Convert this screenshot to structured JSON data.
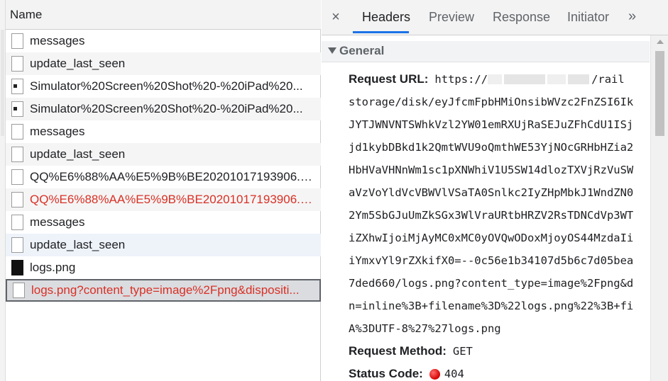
{
  "list": {
    "header": "Name",
    "rows": [
      {
        "name": "messages",
        "icon": "document-icon",
        "error": false
      },
      {
        "name": "update_last_seen",
        "icon": "document-icon",
        "error": false
      },
      {
        "name": "Simulator%20Screen%20Shot%20-%20iPad%20...",
        "icon": "image-file-icon",
        "error": false
      },
      {
        "name": "Simulator%20Screen%20Shot%20-%20iPad%20...",
        "icon": "image-file-icon",
        "error": false
      },
      {
        "name": "messages",
        "icon": "document-icon",
        "error": false
      },
      {
        "name": "update_last_seen",
        "icon": "document-icon",
        "error": false
      },
      {
        "name": "QQ%E6%88%AA%E5%9B%BE20201017193906.p...",
        "icon": "document-icon",
        "error": false
      },
      {
        "name": "QQ%E6%88%AA%E5%9B%BE20201017193906.p...",
        "icon": "document-icon",
        "error": true
      },
      {
        "name": "messages",
        "icon": "document-icon",
        "error": false
      },
      {
        "name": "update_last_seen",
        "icon": "document-icon",
        "error": false
      },
      {
        "name": "logs.png",
        "icon": "image-thumbnail-icon",
        "error": false
      },
      {
        "name": "logs.png?content_type=image%2Fpng&dispositi...",
        "icon": "document-icon",
        "error": true
      }
    ]
  },
  "tabs": {
    "close": "×",
    "items": [
      "Headers",
      "Preview",
      "Response",
      "Initiator"
    ],
    "more": "»"
  },
  "general": {
    "title": "General",
    "request_url_label": "Request URL:",
    "url_first": "https://",
    "url_first_tail": "/rail",
    "url_lines": [
      "storage/disk/eyJfcmFpbHMiOnsibWVzc2FnZSI6Ik",
      "JYTJWNVNTSWhkVzl2YW01emRXUjRaSEJuZFhCdU1ISj",
      "jd1kybDBkd1k2QmtWVU9oQmthWE53YjNOcGRHbHZia2",
      "HbHVaVHNnWm1sc1pXNWhiV1U5SW14dlozTXVjRzVuSW",
      "aVzVoYldVcVBWVlVSaTA0Snlkc2IyZHpMbkJ1WndZN0",
      "2Ym5SbGJuUmZkSGx3WlVraURtbHRZV2RsTDNCdVp3WT",
      "iZXhwIjoiMjAyMC0xMC0yOVQwODoxMjoyOS44MzdaIi",
      "iYmxvYl9rZXkifX0=--0c56e1b34107d5b6c7d05bea",
      "7ded660/logs.png?content_type=image%2Fpng&d",
      "n=inline%3B+filename%3D%22logs.png%22%3B+fi",
      "A%3DUTF-8%27%27logs.png"
    ],
    "method_label": "Request Method:",
    "method_value": "GET",
    "status_label": "Status Code:",
    "status_value": "404",
    "status_color": "#d50000"
  }
}
